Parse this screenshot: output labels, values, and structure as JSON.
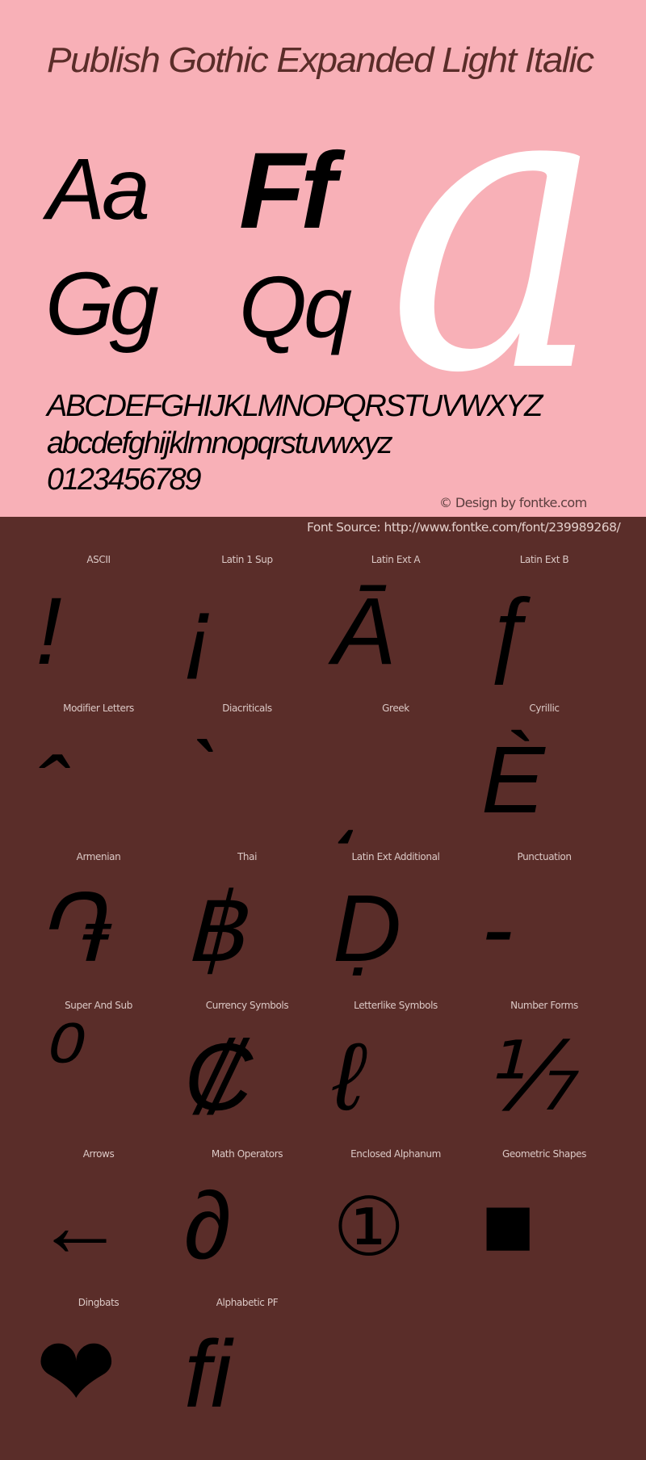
{
  "colors": {
    "hero_background": "#F8B0B7",
    "panel_background": "#5A2D29",
    "title_text": "#5A2D29",
    "glyph": "#000000",
    "big_glyph": "#FFFFFF",
    "label_text": "#DCC9C6"
  },
  "hero": {
    "title": "Publish Gothic Expanded Light Italic",
    "specimens": [
      "Aa",
      "Ff",
      "Gg",
      "Qq"
    ],
    "big_glyph": "a",
    "uppercase": "ABCDEFGHIJKLMNOPQRSTUVWXYZ",
    "lowercase": "abcdefghijklmnopqrstuvwxyz",
    "digits": "0123456789",
    "credit": "© Design by fontke.com"
  },
  "source": "Font Source: http://www.fontke.com/font/239989268/",
  "blocks": [
    {
      "label": "ASCII",
      "glyph": "!"
    },
    {
      "label": "Latin 1 Sup",
      "glyph": "¡"
    },
    {
      "label": "Latin Ext A",
      "glyph": "Ā"
    },
    {
      "label": "Latin Ext B",
      "glyph": "ƒ"
    },
    {
      "label": "Modifier Letters",
      "glyph": "ˆ"
    },
    {
      "label": "Diacriticals",
      "glyph": "̀"
    },
    {
      "label": "Greek",
      "glyph": "͵"
    },
    {
      "label": "Cyrillic",
      "glyph": "Ѐ"
    },
    {
      "label": "Armenian",
      "glyph": "֏"
    },
    {
      "label": "Thai",
      "glyph": "฿"
    },
    {
      "label": "Latin Ext Additional",
      "glyph": "Ḍ"
    },
    {
      "label": "Punctuation",
      "glyph": "‐"
    },
    {
      "label": "Super And Sub",
      "glyph": "⁰"
    },
    {
      "label": "Currency Symbols",
      "glyph": "₡"
    },
    {
      "label": "Letterlike Symbols",
      "glyph": "ℓ"
    },
    {
      "label": "Number Forms",
      "glyph": "⅐"
    },
    {
      "label": "Arrows",
      "glyph": "←"
    },
    {
      "label": "Math Operators",
      "glyph": "∂"
    },
    {
      "label": "Enclosed Alphanum",
      "glyph": "①"
    },
    {
      "label": "Geometric Shapes",
      "glyph": "■"
    },
    {
      "label": "Dingbats",
      "glyph": "❤"
    },
    {
      "label": "Alphabetic PF",
      "glyph": "ﬁ"
    }
  ]
}
